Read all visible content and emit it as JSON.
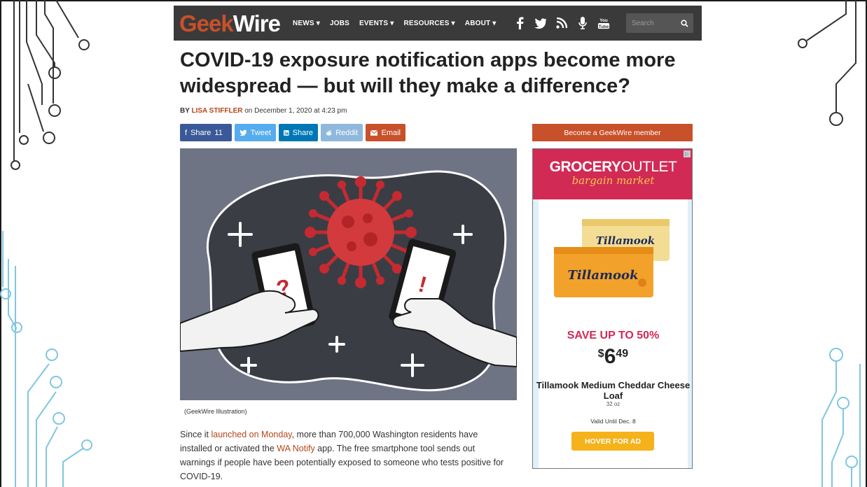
{
  "site": {
    "logo_geek": "Geek",
    "logo_wire": "Wire",
    "nav": [
      "NEWS ▾",
      "JOBS",
      "EVENTS ▾",
      "RESOURCES ▾",
      "ABOUT ▾"
    ],
    "search_placeholder": "Search"
  },
  "article": {
    "headline": "COVID-19 exposure notification apps become more widespread — but will they make a difference?",
    "byline_prefix": "BY ",
    "author": "LISA STIFFLER",
    "date": " on December 1, 2020 at 4:23 pm",
    "share": {
      "facebook": "Share",
      "facebook_count": "11",
      "twitter": "Tweet",
      "linkedin": "Share",
      "reddit": "Reddit",
      "email": "Email"
    },
    "caption": "(GeekWire Illustration)",
    "body_1": "Since it ",
    "body_link_1": "launched on Monday",
    "body_2": ", more than 700,000 Washington residents have installed or activated the ",
    "body_link_2": "WA Notify",
    "body_3": " app. The free smartphone tool sends out warnings if people have been potentially exposed to someone who tests positive for COVID-19."
  },
  "sidebar": {
    "member_button": "Become a GeekWire member",
    "ad": {
      "brand_bold": "GROCERY",
      "brand_light": "OUTLET",
      "tagline": "bargain market",
      "product_brand": "Tillamook",
      "save_text": "SAVE UP TO 50%",
      "price_currency": "$",
      "price_dollars": "6",
      "price_cents": "49",
      "product_name": "Tillamook Medium Cheddar Cheese Loaf",
      "product_size": "32 oz",
      "valid_text": "Valid Until Dec. 8",
      "cta": "HOVER FOR AD"
    }
  },
  "colors": {
    "accent": "#c8502a",
    "nav_bg": "#3a3a3a",
    "ad_red": "#d12a55",
    "ad_yellow": "#f5b21b"
  }
}
